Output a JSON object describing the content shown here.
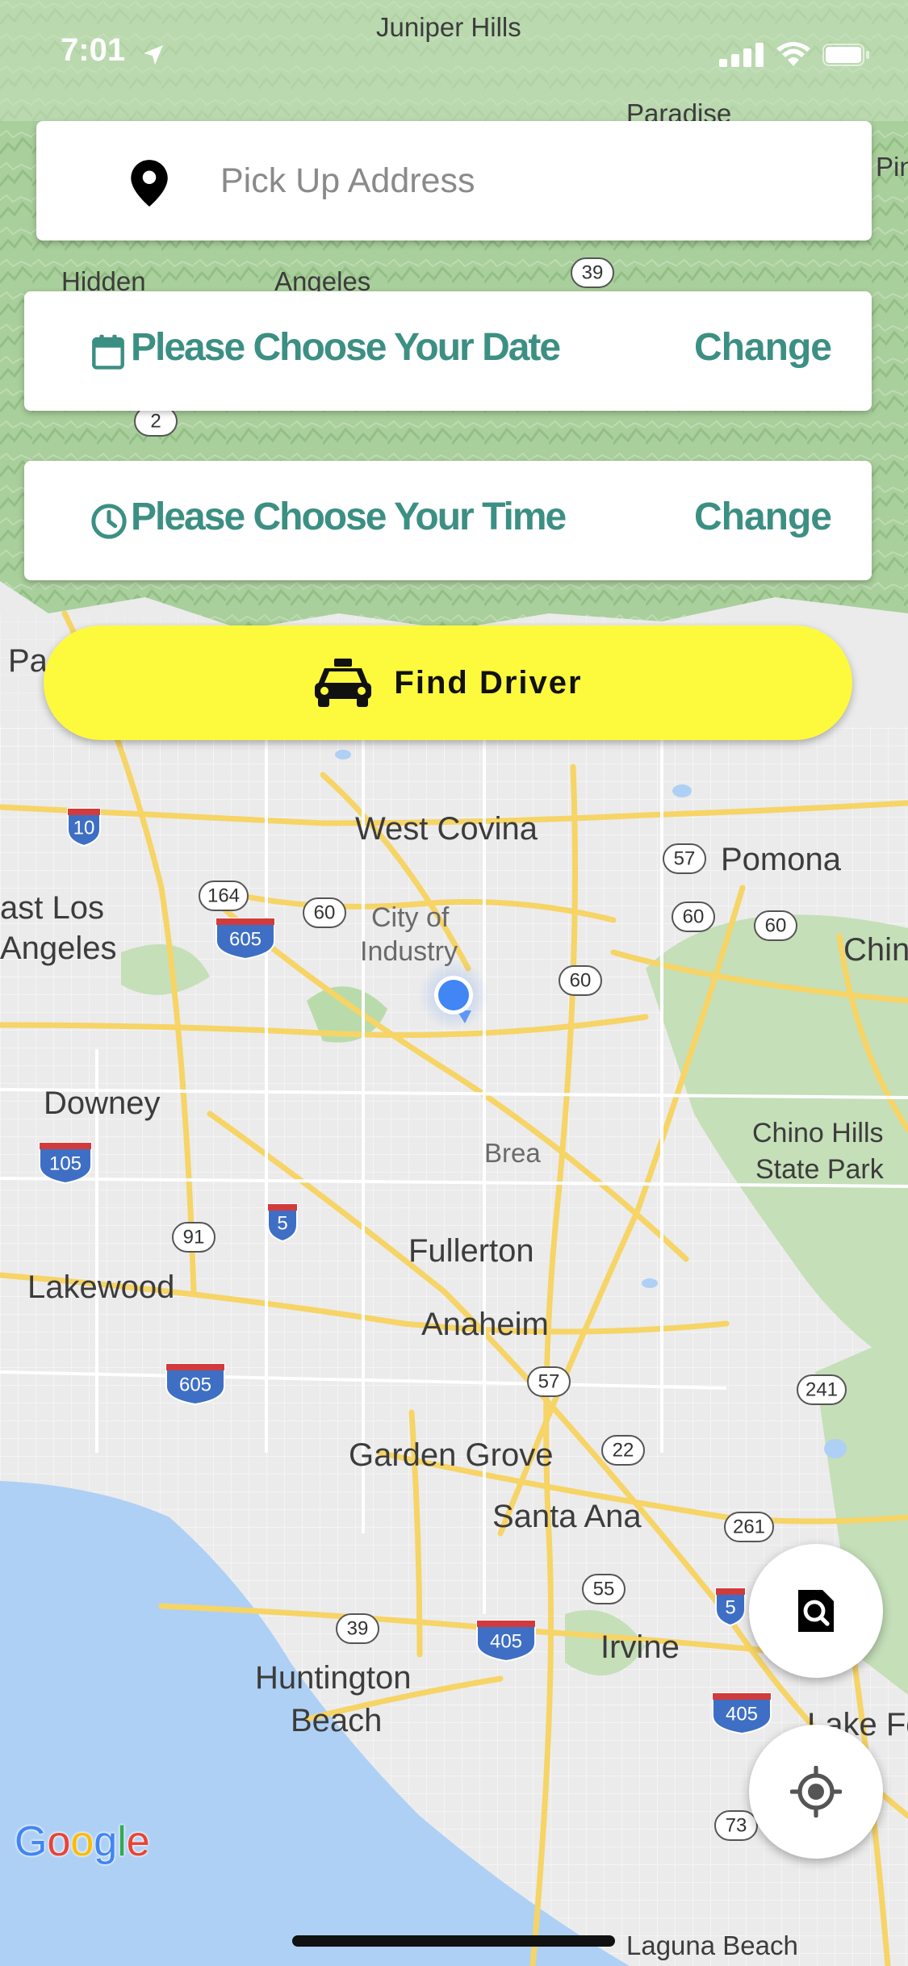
{
  "status_bar": {
    "time": "7:01"
  },
  "pickup": {
    "placeholder": "Pick Up Address",
    "value": ""
  },
  "date_card": {
    "label": "Please Choose Your Date",
    "action": "Change"
  },
  "time_card": {
    "label": "Please Choose Your Time",
    "action": "Change"
  },
  "find_driver": {
    "label": "Find Driver"
  },
  "map": {
    "provider_logo": "Google",
    "labels": {
      "juniper_hills": "Juniper Hills",
      "paradise": "Paradise",
      "pin_partial": "Pin",
      "hidden": "Hidden",
      "angeles": "Angeles",
      "pa_partial": "Pa",
      "west_covina": "West Covina",
      "pomona": "Pomona",
      "east_los_1": "ast Los",
      "east_los_2": "Angeles",
      "city_of": "City of",
      "industry": "Industry",
      "chin_partial": "Chin",
      "downey": "Downey",
      "brea": "Brea",
      "chino_hills_1": "Chino Hills",
      "chino_hills_2": "State Park",
      "fullerton": "Fullerton",
      "lakewood": "Lakewood",
      "anaheim": "Anaheim",
      "garden_grove": "Garden Grove",
      "santa_ana": "Santa Ana",
      "irvine": "Irvine",
      "huntington_1": "Huntington",
      "huntington_2": "Beach",
      "lake_forest_partial": "Lake Fo",
      "laguna_beach": "Laguna Beach"
    },
    "shields": {
      "r39a": "39",
      "r2": "2",
      "r10": "10",
      "r57a": "57",
      "r164": "164",
      "r60a": "60",
      "r605a": "605",
      "r60b": "60",
      "r60c": "60",
      "r60d": "60",
      "r105": "105",
      "r5a": "5",
      "r91": "91",
      "r605b": "605",
      "r57b": "57",
      "r241": "241",
      "r22": "22",
      "r261": "261",
      "r55": "55",
      "r5b": "5",
      "r39b": "39",
      "r405a": "405",
      "r405b": "405",
      "r73": "73"
    }
  },
  "colors": {
    "accent_teal": "#3c8f83",
    "button_yellow": "#fdfa3e",
    "user_dot": "#4285f4",
    "ocean": "#aed0f5",
    "terrain_green": "#a8d2a0"
  },
  "icons": {
    "pickup": "map-pin-icon",
    "date": "calendar-icon",
    "time": "clock-icon",
    "find_driver": "taxi-icon",
    "search_fab": "search-document-icon",
    "locate_fab": "crosshair-icon"
  }
}
